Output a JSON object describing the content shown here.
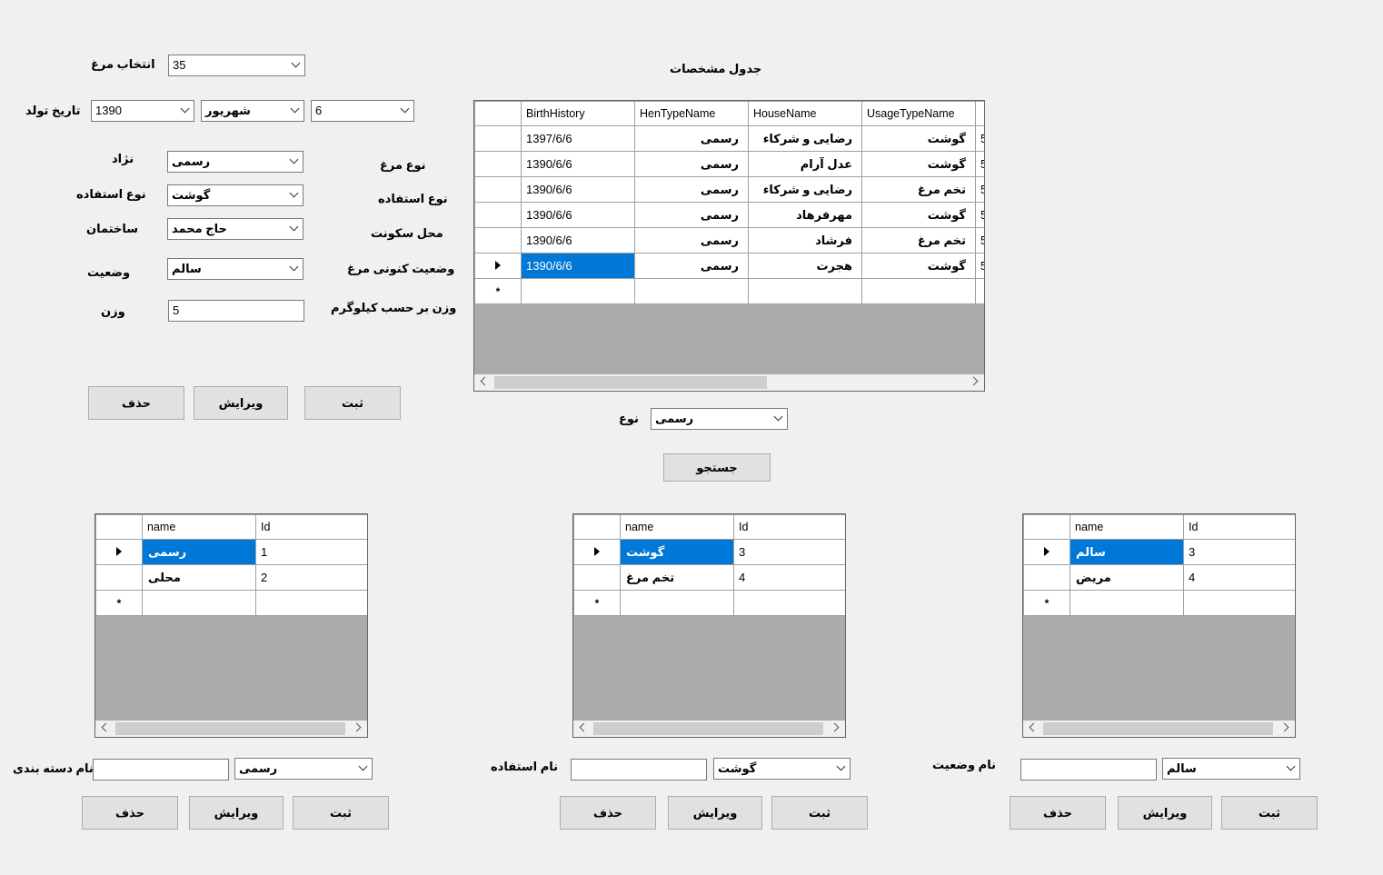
{
  "main_form": {
    "select_hen_label": "انتخاب مرغ",
    "select_hen_value": "35",
    "birth_date_label": "تاریخ تولد",
    "birth_year": "1390",
    "birth_month": "شهریور",
    "birth_day": "6",
    "breed_label": "نژاد",
    "breed_value": "رسمی",
    "usage_label": "نوع استفاده",
    "usage_value": "گوشت",
    "building_label": "ساختمان",
    "building_value": "حاج محمد",
    "status_label": "وضعیت",
    "status_value": "سالم",
    "weight_label": "وزن",
    "weight_value": "5",
    "hen_type_label": "نوع مرغ",
    "usage_type_label": "نوع استفاده",
    "residence_label": "محل سکونت",
    "current_status_label": "وضعیت کنونی مرغ",
    "weight_kg_label": "وزن بر حسب کیلوگرم",
    "buttons": {
      "save": "ثبت",
      "edit": "ویرایش",
      "delete": "حذف"
    }
  },
  "specs": {
    "title": "جدول مشخصات",
    "columns": [
      "BirthHistory",
      "HenTypeName",
      "HouseName",
      "UsageTypeName",
      ""
    ],
    "rows": [
      [
        "1397/6/6",
        "رسمی",
        "رضایی و شرکاء",
        "گوشت",
        "5"
      ],
      [
        "1390/6/6",
        "رسمی",
        "عدل آرام",
        "گوشت",
        "5"
      ],
      [
        "1390/6/6",
        "رسمی",
        "رضایی و شرکاء",
        "تخم مرغ",
        "5"
      ],
      [
        "1390/6/6",
        "رسمی",
        "مهرفرهاد",
        "گوشت",
        "5"
      ],
      [
        "1390/6/6",
        "رسمی",
        "فرشاد",
        "تخم مرغ",
        "5"
      ],
      [
        "1390/6/6",
        "رسمی",
        "هجرت",
        "گوشت",
        "5"
      ]
    ],
    "selected_row": 5,
    "filter_label": "نوع",
    "filter_value": "رسمی",
    "search_button": "جستجو"
  },
  "panels": [
    {
      "columns": [
        "name",
        "Id"
      ],
      "rows": [
        [
          "رسمی",
          "1"
        ],
        [
          "محلی",
          "2"
        ]
      ],
      "name_label": "نام دسته بندی",
      "text_value": "",
      "combo_value": "رسمی",
      "buttons": {
        "save": "ثبت",
        "edit": "ویرایش",
        "delete": "حذف"
      }
    },
    {
      "columns": [
        "name",
        "Id"
      ],
      "rows": [
        [
          "گوشت",
          "3"
        ],
        [
          "تخم مرغ",
          "4"
        ]
      ],
      "name_label": "نام استفاده",
      "text_value": "",
      "combo_value": "گوشت",
      "buttons": {
        "save": "ثبت",
        "edit": "ویرایش",
        "delete": "حذف"
      }
    },
    {
      "columns": [
        "name",
        "Id"
      ],
      "rows": [
        [
          "سالم",
          "3"
        ],
        [
          "مریض",
          "4"
        ]
      ],
      "name_label": "نام وضعیت",
      "text_value": "",
      "combo_value": "سالم",
      "buttons": {
        "save": "ثبت",
        "edit": "ویرایش",
        "delete": "حذف"
      }
    }
  ],
  "colors": {
    "selection": "#0078d7",
    "background": "#f0f0f0",
    "grid_empty": "#ababab"
  }
}
